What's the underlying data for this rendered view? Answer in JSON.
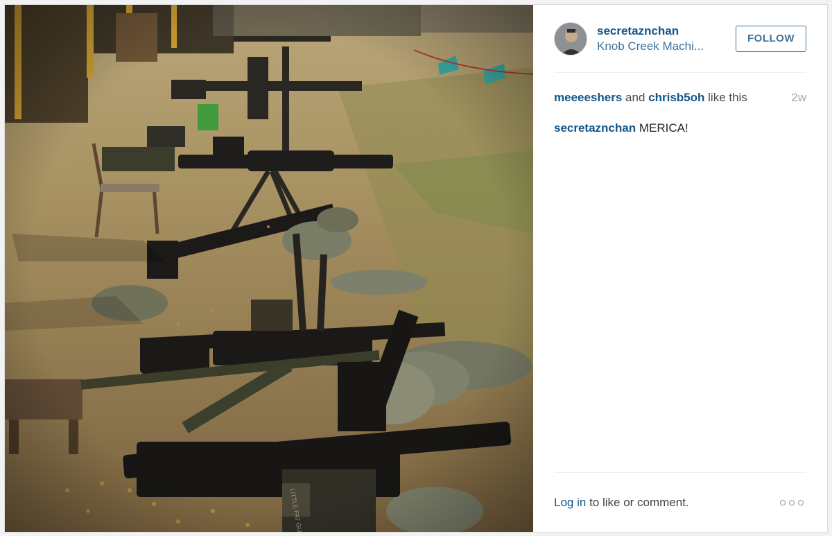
{
  "post": {
    "username": "secretaznchan",
    "location": "Knob Creek Machi...",
    "follow_label": "FOLLOW",
    "likes": {
      "user1": "meeeeshers",
      "and_text": "and",
      "user2": "chrisb5oh",
      "suffix": "like this"
    },
    "time_ago": "2w",
    "caption": {
      "user": "secretaznchan",
      "text": "MERICA!"
    },
    "login_link": "Log in",
    "login_suffix": "to like or comment.",
    "photo_ammo_can_text": "LITTLE FAT GUY"
  },
  "colors": {
    "link": "#125688",
    "follow": "#3f729b",
    "muted": "#a5a7aa"
  },
  "icons": {
    "more": "more-options-icon"
  }
}
